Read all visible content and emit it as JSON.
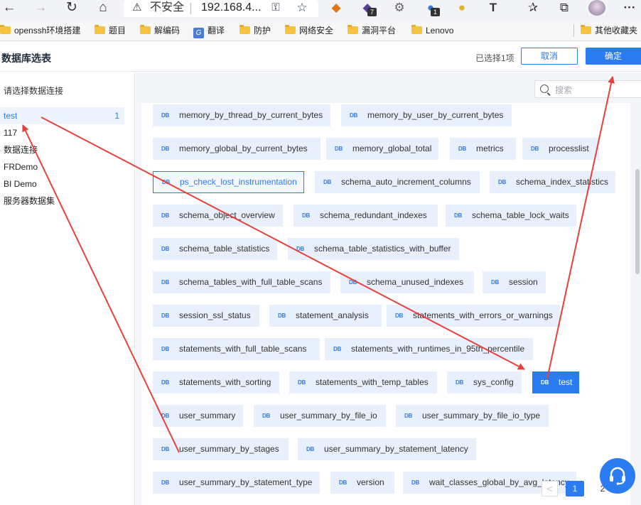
{
  "browser": {
    "back_glyph": "←",
    "forward_glyph": "→",
    "refresh_glyph": "↻",
    "home_glyph": "⌂",
    "security_warning": "不安全",
    "url": "192.168.4...",
    "ext_badge_1": "7",
    "ext_badge_2": "1",
    "ext_t": "T",
    "menu_glyph": "···"
  },
  "bookmarks": [
    {
      "label": "openssh环境搭建"
    },
    {
      "label": "题目"
    },
    {
      "label": "解编码"
    },
    {
      "label": "翻译"
    },
    {
      "label": "防护"
    },
    {
      "label": "网络安全"
    },
    {
      "label": "漏洞平台"
    },
    {
      "label": "Lenovo"
    },
    {
      "label": "其他收藏夹"
    }
  ],
  "dialog": {
    "title": "数据库选表",
    "selected_count": "已选择1项",
    "cancel_label": "取消",
    "ok_label": "确定"
  },
  "connections": {
    "header": "请选择数据连接",
    "items": [
      {
        "label": "test",
        "count": "1",
        "active": true
      },
      {
        "label": "117"
      },
      {
        "label": "数据连接"
      },
      {
        "label": "FRDemo"
      },
      {
        "label": "BI Demo"
      },
      {
        "label": "服务器数据集"
      }
    ]
  },
  "search": {
    "placeholder": "搜索"
  },
  "db_glyph": "DB",
  "tables": [
    {
      "name": "memory_by_thread_by_current_bytes"
    },
    {
      "name": "memory_by_user_by_current_bytes"
    },
    {
      "name": "memory_global_by_current_bytes"
    },
    {
      "name": "memory_global_total"
    },
    {
      "name": "metrics"
    },
    {
      "name": "processlist"
    },
    {
      "name": "ps_check_lost_instrumentation",
      "state": "hover"
    },
    {
      "name": "schema_auto_increment_columns"
    },
    {
      "name": "schema_index_statistics"
    },
    {
      "name": "schema_object_overview"
    },
    {
      "name": "schema_redundant_indexes"
    },
    {
      "name": "schema_table_lock_waits"
    },
    {
      "name": "schema_table_statistics"
    },
    {
      "name": "schema_table_statistics_with_buffer"
    },
    {
      "name": "schema_tables_with_full_table_scans"
    },
    {
      "name": "schema_unused_indexes"
    },
    {
      "name": "session"
    },
    {
      "name": "session_ssl_status"
    },
    {
      "name": "statement_analysis"
    },
    {
      "name": "statements_with_errors_or_warnings"
    },
    {
      "name": "statements_with_full_table_scans"
    },
    {
      "name": "statements_with_runtimes_in_95th_percentile"
    },
    {
      "name": "statements_with_sorting"
    },
    {
      "name": "statements_with_temp_tables"
    },
    {
      "name": "sys_config"
    },
    {
      "name": "test",
      "state": "selected"
    },
    {
      "name": "user_summary"
    },
    {
      "name": "user_summary_by_file_io"
    },
    {
      "name": "user_summary_by_file_io_type"
    },
    {
      "name": "user_summary_by_stages"
    },
    {
      "name": "user_summary_by_statement_latency"
    },
    {
      "name": "user_summary_by_statement_type"
    },
    {
      "name": "version"
    },
    {
      "name": "wait_classes_global_by_avg_latency"
    }
  ],
  "pagination": {
    "prev_glyph": "<",
    "current": "1",
    "next": "2"
  },
  "colors": {
    "accent": "#2a7cf0",
    "chip_bg": "#e8f0fd",
    "annotation_arrow": "#e8413c"
  },
  "icons": {
    "support": "headset-icon",
    "search": "search-icon",
    "table": "db-icon",
    "folder": "folder-icon"
  }
}
